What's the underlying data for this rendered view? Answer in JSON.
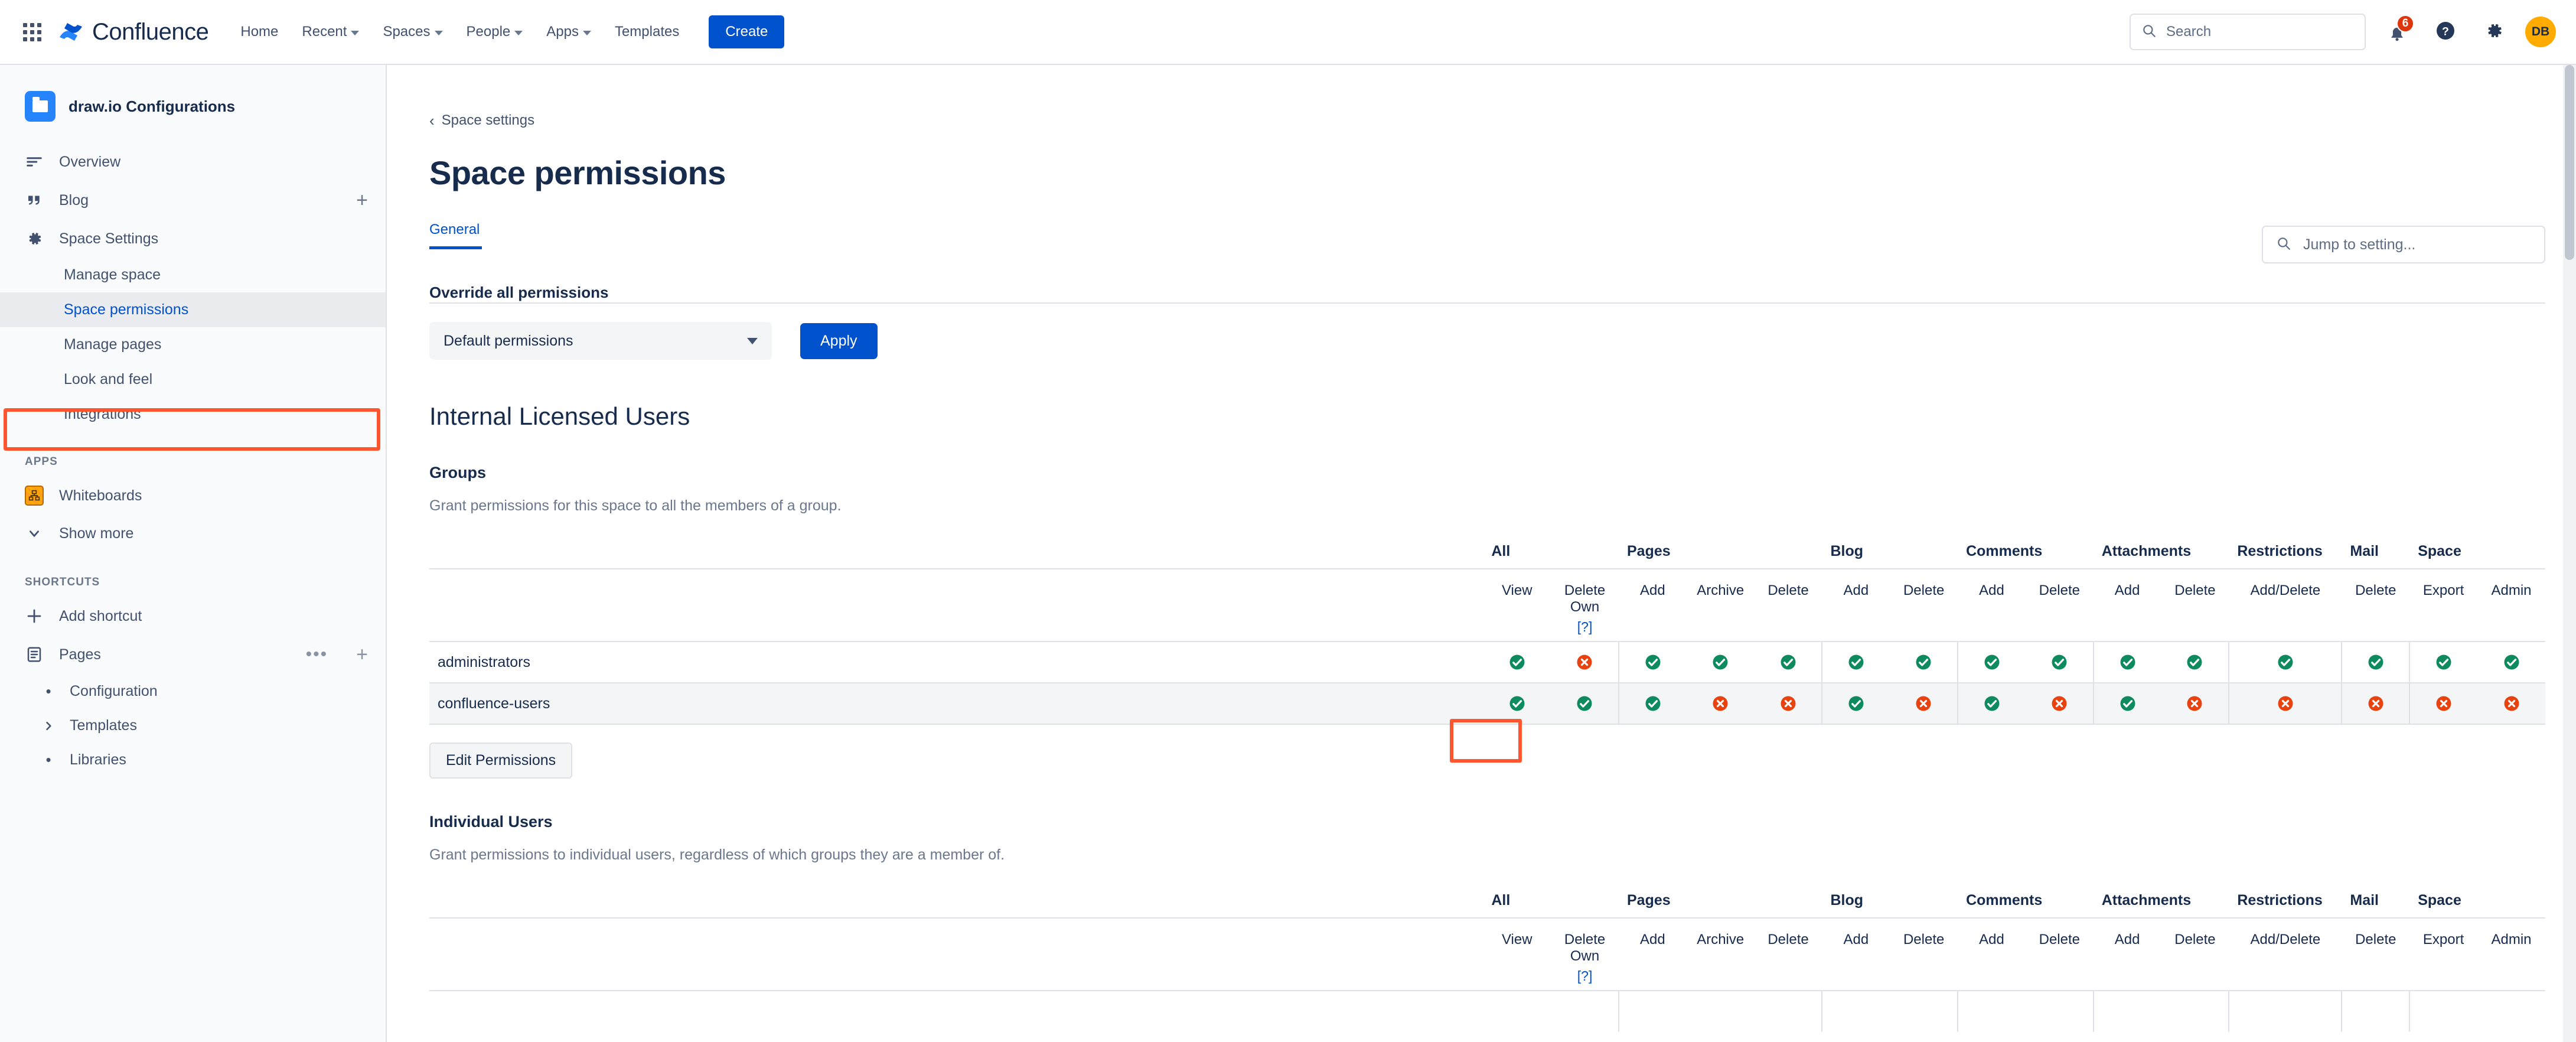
{
  "topnav": {
    "app_switcher_icon": "grid-apps-icon",
    "brand": "Confluence",
    "links": [
      {
        "label": "Home",
        "has_caret": false
      },
      {
        "label": "Recent",
        "has_caret": true
      },
      {
        "label": "Spaces",
        "has_caret": true
      },
      {
        "label": "People",
        "has_caret": true
      },
      {
        "label": "Apps",
        "has_caret": true
      },
      {
        "label": "Templates",
        "has_caret": false
      }
    ],
    "create_label": "Create",
    "search_placeholder": "Search",
    "search_value": "",
    "notification_count": "6",
    "help_icon": "help-question-icon",
    "settings_icon": "gear-icon",
    "avatar_initials": "DB",
    "avatar_color": "#ffab00",
    "brand_color": "#0052cc"
  },
  "sidebar": {
    "space_name": "draw.io Configurations",
    "nav": [
      {
        "label": "Overview",
        "icon": "overview-lines-icon"
      },
      {
        "label": "Blog",
        "icon": "quote-icon",
        "trailing": "plus-icon"
      },
      {
        "label": "Space Settings",
        "icon": "gear-icon"
      }
    ],
    "settings_sub": [
      {
        "label": "Manage space",
        "active": false
      },
      {
        "label": "Space permissions",
        "active": true
      },
      {
        "label": "Manage pages",
        "active": false
      },
      {
        "label": "Look and feel",
        "active": false
      },
      {
        "label": "Integrations",
        "active": false
      }
    ],
    "apps_label": "APPS",
    "apps": [
      {
        "label": "Whiteboards",
        "icon": "whiteboards-icon"
      }
    ],
    "show_more_label": "Show more",
    "shortcuts_label": "SHORTCUTS",
    "add_shortcut_label": "Add shortcut",
    "pages_label": "Pages",
    "pages_children": [
      {
        "label": "Configuration",
        "expandable": false
      },
      {
        "label": "Templates",
        "expandable": true
      },
      {
        "label": "Libraries",
        "expandable": false
      }
    ]
  },
  "main": {
    "breadcrumb": "Space settings",
    "page_title": "Space permissions",
    "tab_general": "General",
    "jump_placeholder": "Jump to setting...",
    "jump_value": "",
    "override_label": "Override all permissions",
    "override_selected": "Default permissions",
    "apply_label": "Apply",
    "internal_heading": "Internal Licensed Users",
    "groups_heading": "Groups",
    "groups_desc": "Grant permissions for this space to all the members of a group.",
    "edit_permissions_label": "Edit Permissions",
    "individual_heading": "Individual Users",
    "individual_desc": "Grant permissions to individual users, regardless of which groups they are a member of.",
    "help_marker": "[?]"
  },
  "permissions_table": {
    "group_headers": [
      {
        "label": "All",
        "span": 2
      },
      {
        "label": "Pages",
        "span": 3
      },
      {
        "label": "Blog",
        "span": 2
      },
      {
        "label": "Comments",
        "span": 2
      },
      {
        "label": "Attachments",
        "span": 2
      },
      {
        "label": "Restrictions",
        "span": 1
      },
      {
        "label": "Mail",
        "span": 1
      },
      {
        "label": "Space",
        "span": 2
      }
    ],
    "sub_headers": [
      "View",
      "Delete Own",
      "Add",
      "Archive",
      "Delete",
      "Add",
      "Delete",
      "Add",
      "Delete",
      "Add",
      "Delete",
      "Add/Delete",
      "Delete",
      "Export",
      "Admin"
    ],
    "delete_own_line1": "Delete",
    "delete_own_line2": "Own",
    "rows": [
      {
        "name": "administrators",
        "values": [
          "yes",
          "no",
          "yes",
          "yes",
          "yes",
          "yes",
          "yes",
          "yes",
          "yes",
          "yes",
          "yes",
          "yes",
          "yes",
          "yes",
          "yes"
        ]
      },
      {
        "name": "confluence-users",
        "values": [
          "yes",
          "yes",
          "yes",
          "no",
          "no",
          "yes",
          "no",
          "yes",
          "no",
          "yes",
          "no",
          "no",
          "no",
          "no",
          "no"
        ]
      }
    ],
    "yes_color": "#0e8a5f",
    "no_color": "#e8420f"
  },
  "individual_table": {
    "group_headers": [
      {
        "label": "All",
        "span": 2
      },
      {
        "label": "Pages",
        "span": 3
      },
      {
        "label": "Blog",
        "span": 2
      },
      {
        "label": "Comments",
        "span": 2
      },
      {
        "label": "Attachments",
        "span": 2
      },
      {
        "label": "Restrictions",
        "span": 1
      },
      {
        "label": "Mail",
        "span": 1
      },
      {
        "label": "Space",
        "span": 2
      }
    ],
    "sub_headers": [
      "View",
      "Delete Own",
      "Add",
      "Archive",
      "Delete",
      "Add",
      "Delete",
      "Add",
      "Delete",
      "Add",
      "Delete",
      "Add/Delete",
      "Delete",
      "Export",
      "Admin"
    ]
  },
  "highlights": {
    "color": "#ff5630",
    "sidebar_target": "Space permissions",
    "cell_target": "confluence-users / All / View"
  }
}
